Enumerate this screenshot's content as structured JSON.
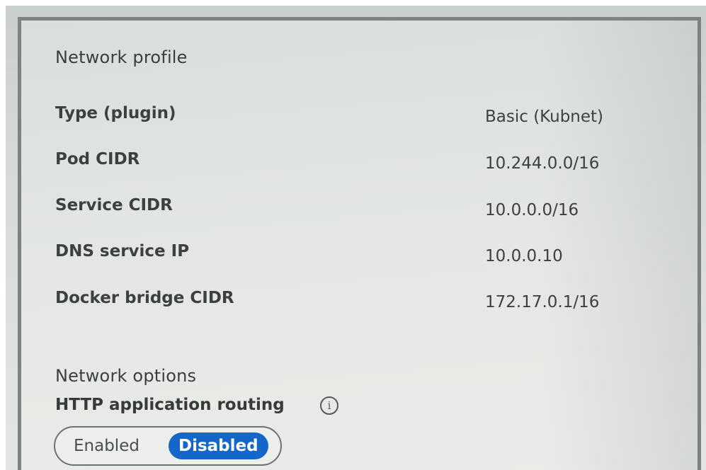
{
  "network_profile": {
    "title": "Network profile",
    "rows": [
      {
        "label": "Type (plugin)",
        "value": "Basic (Kubnet)"
      },
      {
        "label": "Pod CIDR",
        "value": "10.244.0.0/16"
      },
      {
        "label": "Service CIDR",
        "value": "10.0.0.0/16"
      },
      {
        "label": "DNS service IP",
        "value": "10.0.0.10"
      },
      {
        "label": "Docker bridge CIDR",
        "value": "172.17.0.1/16"
      }
    ]
  },
  "network_options": {
    "title": "Network options",
    "http_routing": {
      "label": "HTTP application routing",
      "info_icon": "info-icon",
      "options": [
        "Enabled",
        "Disabled"
      ],
      "selected": "Disabled"
    }
  },
  "colors": {
    "accent": "#1466c8",
    "panel_border": "#7d8380"
  }
}
